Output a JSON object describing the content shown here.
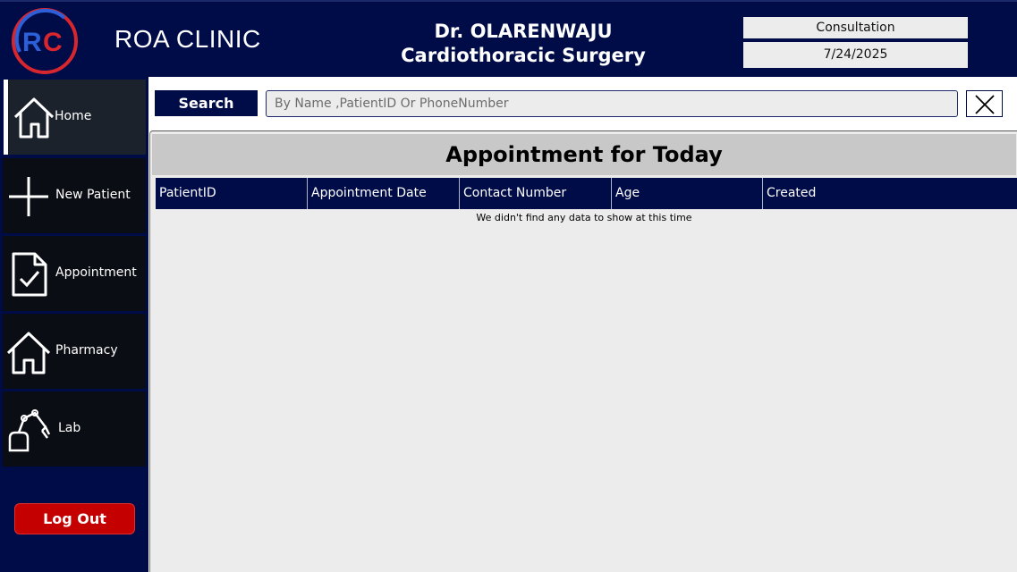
{
  "header": {
    "brand": "ROA CLINIC",
    "doctor_name": "Dr. OLARENWAJU",
    "specialty": "Cardiothoracic Surgery",
    "mode": "Consultation",
    "date": "7/24/2025"
  },
  "sidebar": {
    "items": [
      {
        "label": "Home",
        "icon": "home-icon",
        "active": true
      },
      {
        "label": "New Patient",
        "icon": "plus-icon"
      },
      {
        "label": "Appointment",
        "icon": "document-check-icon"
      },
      {
        "label": "Pharmacy",
        "icon": "home-icon"
      },
      {
        "label": "Lab",
        "icon": "robot-arm-icon"
      }
    ],
    "logout_label": "Log Out"
  },
  "search": {
    "button_label": "Search",
    "placeholder": "By Name ,PatientID Or PhoneNumber",
    "value": ""
  },
  "appointments": {
    "title": "Appointment for Today",
    "columns": [
      "PatientID",
      "Appointment Date",
      "Contact Number",
      "Age",
      "Created"
    ],
    "rows": [],
    "empty_message": "We didn't find any data to show at this time"
  },
  "colors": {
    "navy": "#000c48",
    "logout_red": "#c40000",
    "panel_gray": "#ececec",
    "title_gray": "#c8c8c8"
  }
}
